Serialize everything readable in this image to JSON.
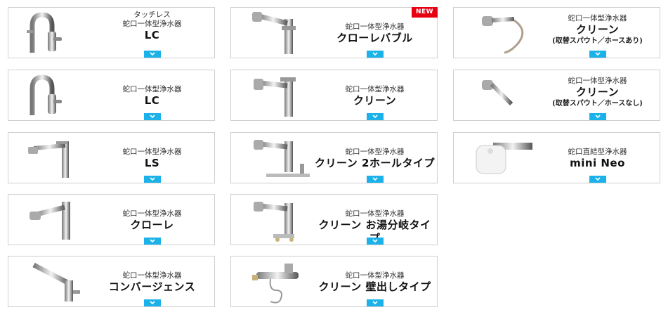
{
  "products": [
    {
      "pre": [
        "タッチレス",
        "蛇口一体型浄水器"
      ],
      "name": "LC",
      "sub": "",
      "badge": "",
      "icon": "faucet-gooseneck-icon"
    },
    {
      "pre": [
        "蛇口一体型浄水器"
      ],
      "name": "クローレバブル",
      "sub": "",
      "badge": "NEW",
      "icon": "faucet-pullout-icon"
    },
    {
      "pre": [
        "蛇口一体型浄水器"
      ],
      "name": "クリーン",
      "sub": "(取替スパウト／ホースあり)",
      "badge": "",
      "icon": "spout-hose-icon"
    },
    {
      "pre": [
        "蛇口一体型浄水器"
      ],
      "name": "LC",
      "sub": "",
      "badge": "",
      "icon": "faucet-gooseneck-icon"
    },
    {
      "pre": [
        "蛇口一体型浄水器"
      ],
      "name": "クリーン",
      "sub": "",
      "badge": "",
      "icon": "faucet-single-lever-icon"
    },
    {
      "pre": [
        "蛇口一体型浄水器"
      ],
      "name": "クリーン",
      "sub": "(取替スパウト／ホースなし)",
      "badge": "",
      "icon": "spout-icon"
    },
    {
      "pre": [
        "蛇口一体型浄水器"
      ],
      "name": "LS",
      "sub": "",
      "badge": "",
      "icon": "faucet-slim-icon"
    },
    {
      "pre": [
        "蛇口一体型浄水器"
      ],
      "name": "クリーン 2ホールタイプ",
      "sub": "",
      "badge": "",
      "icon": "faucet-2hole-icon"
    },
    {
      "pre": [
        "蛇口直結型浄水器"
      ],
      "name": "mini Neo",
      "sub": "",
      "badge": "",
      "icon": "faucet-mount-filter-icon"
    },
    {
      "pre": [
        "蛇口一体型浄水器"
      ],
      "name": "クローレ",
      "sub": "",
      "badge": "",
      "icon": "faucet-pullout-icon"
    },
    {
      "pre": [
        "蛇口一体型浄水器"
      ],
      "name": "クリーン お湯分岐タイプ",
      "sub": "",
      "badge": "",
      "icon": "faucet-hot-branch-icon"
    },
    {
      "pre": [
        "蛇口一体型浄水器"
      ],
      "name": "コンバージェンス",
      "sub": "",
      "badge": "",
      "icon": "faucet-convergence-icon"
    },
    {
      "pre": [
        "蛇口一体型浄水器"
      ],
      "name": "クリーン 壁出しタイプ",
      "sub": "",
      "badge": "",
      "icon": "faucet-wall-mount-icon"
    }
  ],
  "colors": {
    "accent": "#1bb2ea",
    "badge": "#e60012",
    "border": "#cfcfcf"
  },
  "chevron_icon": "chevron-down-icon"
}
